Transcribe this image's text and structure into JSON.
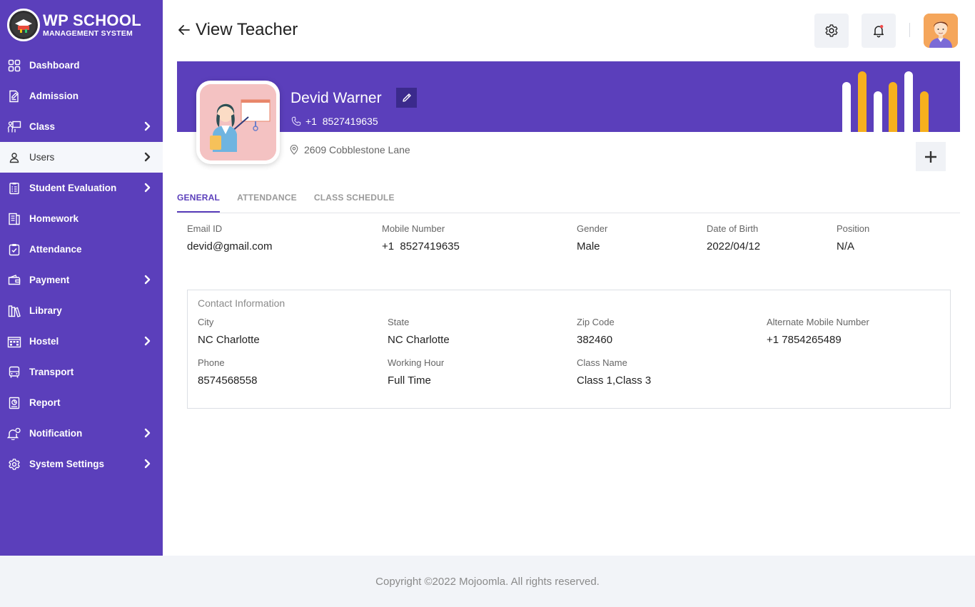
{
  "app": {
    "logo_line1": "WP SCHOOL",
    "logo_line2": "MANAGEMENT SYSTEM"
  },
  "sidebar": {
    "items": [
      {
        "label": "Dashboard",
        "icon": "grid-icon",
        "has_submenu": false,
        "active": false
      },
      {
        "label": "Admission",
        "icon": "edit-document-icon",
        "has_submenu": false,
        "active": false
      },
      {
        "label": "Class",
        "icon": "classroom-icon",
        "has_submenu": true,
        "active": false
      },
      {
        "label": "Users",
        "icon": "user-icon",
        "has_submenu": true,
        "active": true
      },
      {
        "label": "Student Evaluation",
        "icon": "checklist-icon",
        "has_submenu": true,
        "active": false
      },
      {
        "label": "Homework",
        "icon": "homework-icon",
        "has_submenu": false,
        "active": false
      },
      {
        "label": "Attendance",
        "icon": "clipboard-check-icon",
        "has_submenu": false,
        "active": false
      },
      {
        "label": "Payment",
        "icon": "wallet-icon",
        "has_submenu": true,
        "active": false
      },
      {
        "label": "Library",
        "icon": "books-icon",
        "has_submenu": false,
        "active": false
      },
      {
        "label": "Hostel",
        "icon": "building-icon",
        "has_submenu": true,
        "active": false
      },
      {
        "label": "Transport",
        "icon": "bus-icon",
        "has_submenu": false,
        "active": false
      },
      {
        "label": "Report",
        "icon": "report-icon",
        "has_submenu": false,
        "active": false
      },
      {
        "label": "Notification",
        "icon": "bell-alert-icon",
        "has_submenu": true,
        "active": false
      },
      {
        "label": "System Settings",
        "icon": "gear-icon",
        "has_submenu": true,
        "active": false
      }
    ]
  },
  "header": {
    "title": "View Teacher"
  },
  "profile": {
    "name": "Devid Warner",
    "phone": "+1  8527419635",
    "address": "2609 Cobblestone Lane"
  },
  "tabs": [
    {
      "label": "GENERAL",
      "active": true
    },
    {
      "label": "ATTENDANCE",
      "active": false
    },
    {
      "label": "CLASS SCHEDULE",
      "active": false
    }
  ],
  "general": {
    "email_label": "Email ID",
    "email": "devid@gmail.com",
    "mobile_label": "Mobile Number",
    "mobile": "+1  8527419635",
    "gender_label": "Gender",
    "gender": "Male",
    "dob_label": "Date of Birth",
    "dob": "2022/04/12",
    "position_label": "Position",
    "position": "N/A"
  },
  "contact": {
    "title": "Contact Information",
    "city_label": "City",
    "city": "NC Charlotte",
    "state_label": "State",
    "state": "NC Charlotte",
    "zip_label": "Zip Code",
    "zip": "382460",
    "alt_mobile_label": "Alternate Mobile Number",
    "alt_mobile": "+1 7854265489",
    "phone_label": "Phone",
    "phone": "8574568558",
    "working_hour_label": "Working Hour",
    "working_hour": "Full Time",
    "class_name_label": "Class Name",
    "class_name": "Class 1,Class 3"
  },
  "footer": {
    "copyright": "Copyright ©2022 Mojoomla. All rights reserved."
  },
  "colors": {
    "primary": "#5b3fbb",
    "bar_white": "#ffffff",
    "bar_yellow": "#f6b01e",
    "notification_dot": "#f24b4b"
  }
}
